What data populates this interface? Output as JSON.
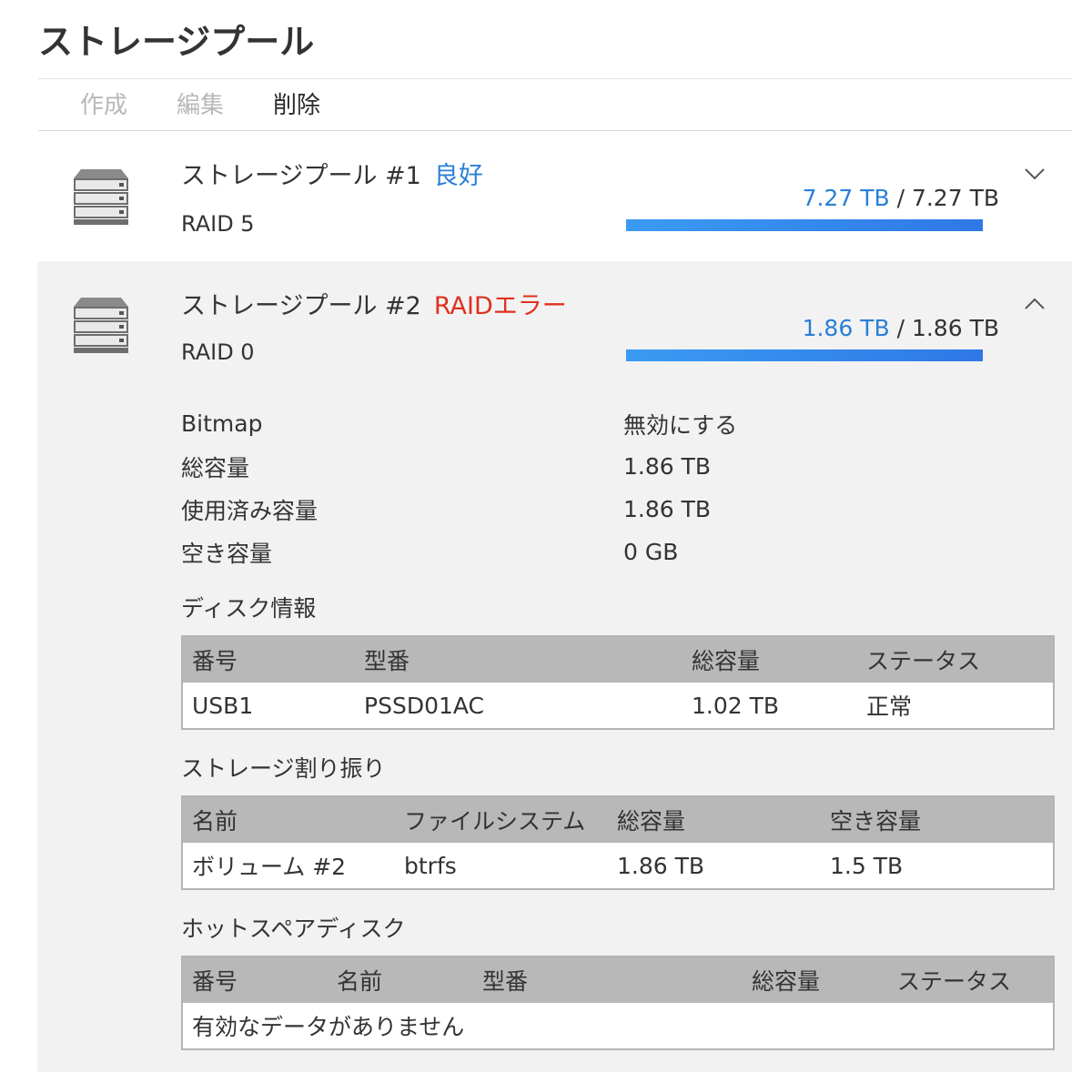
{
  "page": {
    "title": "ストレージプール"
  },
  "toolbar": {
    "create": "作成",
    "edit": "編集",
    "delete": "削除"
  },
  "pools": [
    {
      "name": "ストレージプール #1",
      "status": "良好",
      "raid": "RAID 5",
      "used": "7.27 TB",
      "separator": " / ",
      "total": "7.27 TB",
      "usage_fraction": 1.0,
      "expanded": false
    },
    {
      "name": "ストレージプール #2",
      "status": "RAIDエラー",
      "raid": "RAID 0",
      "used": "1.86 TB",
      "separator": " / ",
      "total": "1.86 TB",
      "usage_fraction": 1.0,
      "expanded": true,
      "properties": [
        {
          "label": "Bitmap",
          "value": "無効にする"
        },
        {
          "label": "総容量",
          "value": "1.86 TB"
        },
        {
          "label": "使用済み容量",
          "value": "1.86 TB"
        },
        {
          "label": "空き容量",
          "value": "0 GB"
        }
      ],
      "disk_info": {
        "title": "ディスク情報",
        "columns": [
          "番号",
          "型番",
          "総容量",
          "ステータス"
        ],
        "rows": [
          [
            "USB1",
            "PSSD01AC",
            "1.02 TB",
            "正常"
          ]
        ]
      },
      "allocation": {
        "title": "ストレージ割り振り",
        "columns": [
          "名前",
          "ファイルシステム",
          "総容量",
          "空き容量"
        ],
        "rows": [
          [
            "ボリューム #2",
            "btrfs",
            "1.86 TB",
            "1.5 TB"
          ]
        ]
      },
      "hot_spare": {
        "title": "ホットスペアディスク",
        "columns": [
          "番号",
          "名前",
          "型番",
          "総容量",
          "ステータス"
        ],
        "empty_message": "有効なデータがありません"
      }
    }
  ],
  "colors": {
    "good": "#2a7fd6",
    "error": "#e0301e",
    "normal": "#2e8b2e",
    "bar": "#3a8cf0"
  },
  "icons": {
    "pool_icon": "server-stack-icon",
    "collapsed": "chevron-down-icon",
    "expanded": "chevron-up-icon"
  }
}
